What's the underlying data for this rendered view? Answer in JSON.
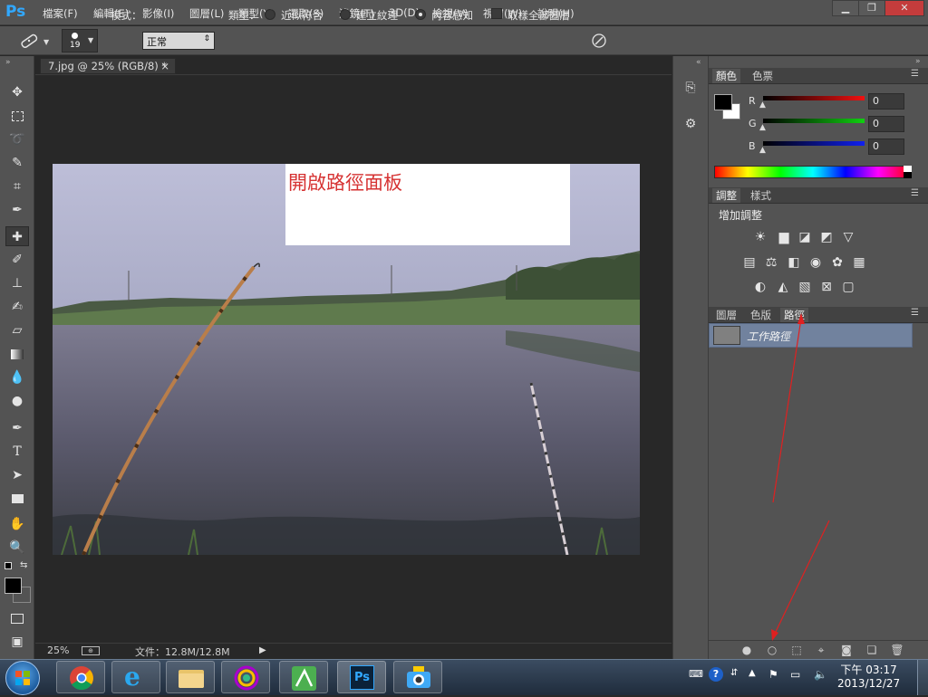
{
  "app": {
    "logo": "Ps"
  },
  "menu": [
    "檔案(F)",
    "編輯(E)",
    "影像(I)",
    "圖層(L)",
    "類型(Y)",
    "選取(S)",
    "濾鏡(T)",
    "3D(D)",
    "檢視(V)",
    "視窗(W)",
    "說明(H)"
  ],
  "window_buttons": {
    "minimize": "▁",
    "restore": "❐",
    "close": "✕"
  },
  "options": {
    "brush_size": "19",
    "mode_label": "模式：",
    "mode_value": "正常",
    "type_label": "類型：",
    "radio_options": [
      "近似符合",
      "建立紋理",
      "內容感知"
    ],
    "selected_radio": "內容感知",
    "sample_all_layers": "取樣全部圖層"
  },
  "document": {
    "tab_title": "7.jpg @ 25% (RGB/8) *",
    "tab_close": "×",
    "annotation": "開啟路徑面板",
    "zoom": "25%",
    "file_info": "文件：12.8M/12.8M"
  },
  "tools": [
    "move-tool",
    "marquee-tool",
    "lasso-tool",
    "quick-selection-tool",
    "crop-tool",
    "eyedropper-tool",
    "spot-healing-tool",
    "brush-tool",
    "clone-stamp-tool",
    "history-brush-tool",
    "eraser-tool",
    "gradient-tool",
    "blur-tool",
    "dodge-tool",
    "pen-tool",
    "type-tool",
    "path-selection-tool",
    "rectangle-tool",
    "hand-tool",
    "zoom-tool"
  ],
  "colors": {
    "foreground": "#000000",
    "background": "#ffffff",
    "accent": "#71829e",
    "arrow": "#e02020"
  },
  "color_panel": {
    "tabs": [
      "顏色",
      "色票"
    ],
    "channels": [
      {
        "label": "R",
        "value": "0"
      },
      {
        "label": "G",
        "value": "0"
      },
      {
        "label": "B",
        "value": "0"
      }
    ]
  },
  "adjust_panel": {
    "tabs": [
      "調整",
      "樣式"
    ],
    "heading": "增加調整"
  },
  "layers_panel": {
    "tabs": [
      "圖層",
      "色版",
      "路徑"
    ],
    "active_tab": "路徑",
    "paths": [
      {
        "name": "工作路徑"
      }
    ]
  },
  "taskbar": {
    "apps": [
      "chrome",
      "internet-explorer",
      "file-explorer",
      "picasa",
      "app-green",
      "photoshop",
      "camera-app"
    ],
    "clock_time": "下午 03:17",
    "clock_date": "2013/12/27"
  }
}
